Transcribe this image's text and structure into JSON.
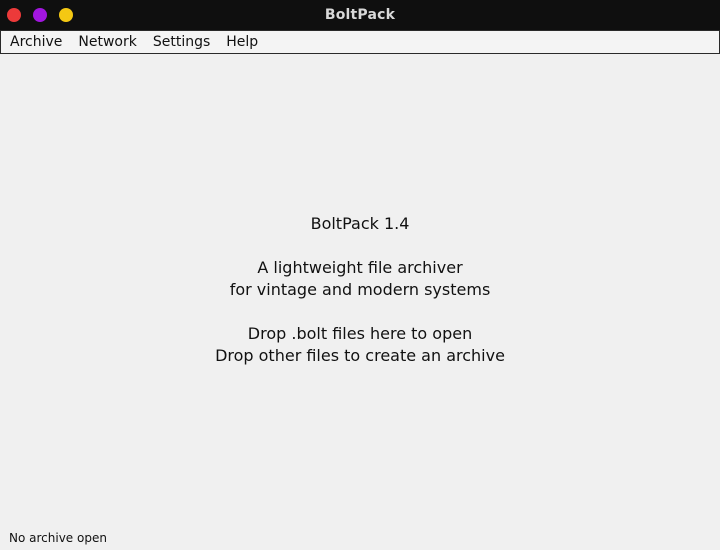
{
  "window": {
    "title": "BoltPack",
    "controls": {
      "close_color": "#ec3a3a",
      "min_color": "#a216e0",
      "max_color": "#f4c813"
    }
  },
  "menubar": {
    "items": [
      {
        "label": "Archive"
      },
      {
        "label": "Network"
      },
      {
        "label": "Settings"
      },
      {
        "label": "Help"
      }
    ]
  },
  "welcome": {
    "app_version": "BoltPack 1.4",
    "description_line1": "A lightweight file archiver",
    "description_line2": "for vintage and modern systems",
    "hint_line1": "Drop .bolt files here to open",
    "hint_line2": "Drop other files to create an archive"
  },
  "statusbar": {
    "text": "No archive open"
  }
}
